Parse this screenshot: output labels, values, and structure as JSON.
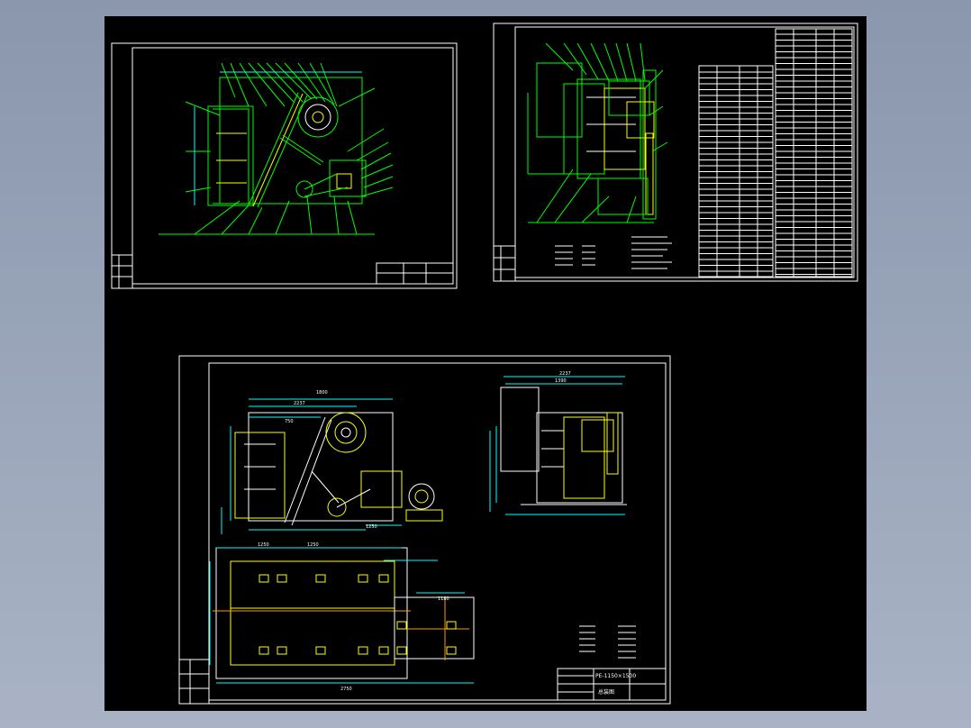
{
  "background_color": "#000000",
  "line_colors": {
    "sheet": "#ffffff",
    "outline": "#00ff00",
    "accent": "#ffff00",
    "highlight": "#00ffff"
  },
  "sheets": [
    {
      "name": "left-top-assembly-drawing",
      "dims": {}
    },
    {
      "name": "right-top-side-view-drawing",
      "dims": {}
    },
    {
      "name": "bottom-layout-drawing",
      "dims": {
        "d1": "1800",
        "d2": "2237",
        "d3": "750",
        "d4": "1250",
        "d5": "1250",
        "d6": "1180",
        "d7": "2237",
        "d8": "1390",
        "d9": "1250",
        "d10": "2750"
      },
      "title_block": {
        "title": "PE-1150×1500",
        "subtitle": "总装图"
      }
    }
  ]
}
